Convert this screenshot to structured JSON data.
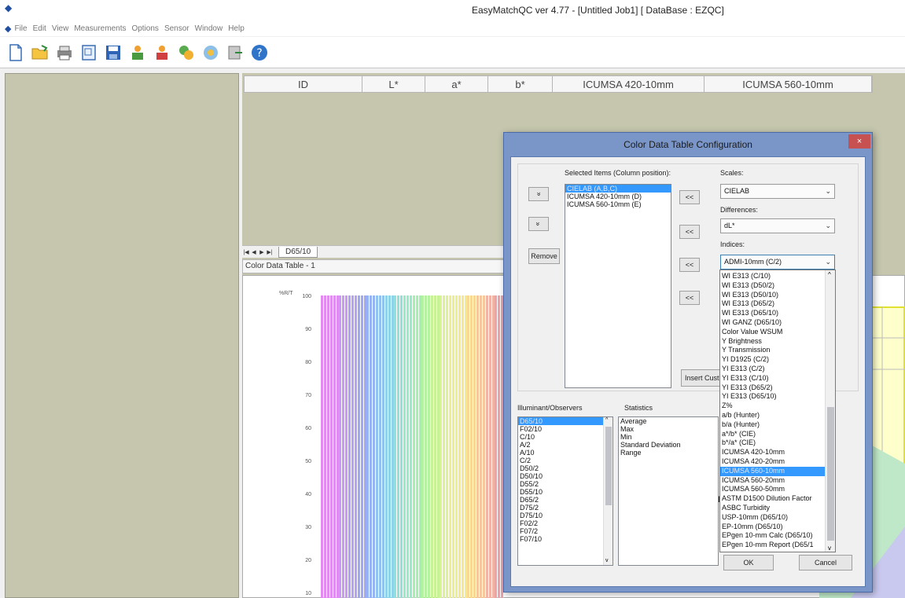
{
  "window": {
    "title": "EasyMatchQC ver 4.77 - [Untitled Job1]   [ DataBase : EZQC]"
  },
  "menu": [
    "File",
    "Edit",
    "View",
    "Measurements",
    "Options",
    "Sensor",
    "Window",
    "Help"
  ],
  "toolbar": {
    "icons": [
      "new-document-icon",
      "open-folder-icon",
      "print-icon",
      "print-preview-icon",
      "save-icon",
      "user-standard-icon",
      "user-sample-icon",
      "database-icon",
      "instrument-icon",
      "export-icon",
      "help-icon"
    ]
  },
  "table": {
    "columns": [
      "ID",
      "L*",
      "a*",
      "b*",
      "ICUMSA 420-10mm",
      "ICUMSA 560-10mm"
    ]
  },
  "sheet": {
    "tab": "D65/10",
    "label": "Color Data Table - 1"
  },
  "chart": {
    "y_unit": "%R/T",
    "y_ticks": [
      "100",
      "90",
      "80",
      "70",
      "60",
      "50",
      "40",
      "30",
      "20",
      "10"
    ]
  },
  "dialog": {
    "title": "Color Data Table Configuration",
    "close": "×",
    "selected_label": "Selected Items (Column position):",
    "selected_items": [
      "CIELAB (A,B,C)",
      "ICUMSA 420-10mm (D)",
      "ICUMSA 560-10mm (E)"
    ],
    "up_button": "«",
    "down_button": "»",
    "remove_button": "Remove",
    "move_buttons": [
      "<<",
      "<<",
      "<<",
      "<<"
    ],
    "scales_label": "Scales:",
    "scales_value": "CIELAB",
    "differences_label": "Differences:",
    "differences_value": "dL*",
    "indices_label": "Indices:",
    "indices_value": "ADMI-10mm (C/2)",
    "insert_custom": "Insert Cust",
    "illum_label": "Illuminant/Observers",
    "illum_items": [
      "D65/10",
      "F02/10",
      "C/10",
      "A/2",
      "A/10",
      "C/2",
      "D50/2",
      "D50/10",
      "D55/2",
      "D55/10",
      "D65/2",
      "D75/2",
      "D75/10",
      "F02/2",
      "F07/2",
      "F07/10"
    ],
    "stats_label": "Statistics",
    "stats_items": [
      "Average",
      "Max",
      "Min",
      "Standard Deviation",
      "Range"
    ],
    "ok_button": "OK",
    "cancel_button": "Cancel",
    "partial_letter": "D"
  },
  "indices_dropdown": {
    "items": [
      "WI E313 (C/10)",
      "WI E313 (D50/2)",
      "WI E313 (D50/10)",
      "WI E313 (D65/2)",
      "WI E313 (D65/10)",
      "WI GANZ (D65/10)",
      "Color Value WSUM",
      "Y Brightness",
      "Y Transmission",
      "YI D1925 (C/2)",
      "YI E313 (C/2)",
      "YI E313 (C/10)",
      "YI E313 (D65/2)",
      "YI E313 (D65/10)",
      "Z%",
      "a/b (Hunter)",
      "b/a (Hunter)",
      "a*/b* (CIE)",
      "b*/a* (CIE)",
      "ICUMSA 420-10mm",
      "ICUMSA 420-20mm",
      "ICUMSA 560-10mm",
      "ICUMSA 560-20mm",
      "ICUMSA 560-50mm",
      "ASTM D1500 Dilution Factor",
      "ASBC Turbidity",
      "USP-10mm (D65/10)",
      "EP-10mm (D65/10)",
      "EPgen 10-mm Calc (D65/10)",
      "EPgen 10-mm Report (D65/1"
    ],
    "selected_index": 21
  }
}
